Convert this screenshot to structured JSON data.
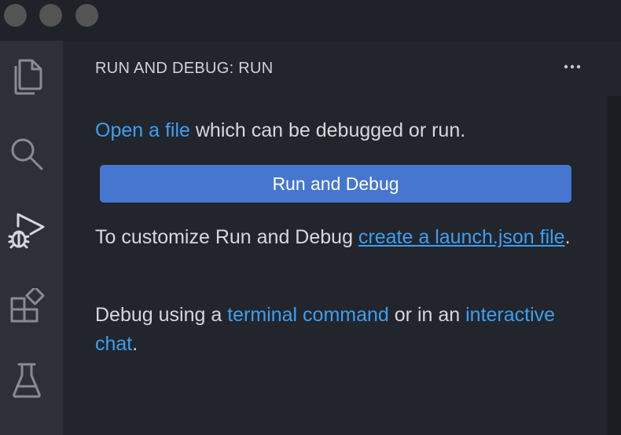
{
  "sidebar": {
    "title": "RUN AND DEBUG: RUN",
    "open_file": {
      "link": "Open a file",
      "rest": " which can be debugged or run."
    },
    "run_button_label": "Run and Debug",
    "customize": {
      "prefix": "To customize Run and Debug ",
      "link": "create a launch.json file",
      "suffix": "."
    },
    "debug_using": {
      "prefix": "Debug using a ",
      "link1": "terminal command",
      "middle": " or in an ",
      "link2": "interactive chat",
      "suffix": "."
    }
  },
  "activity_icons": [
    "files-icon",
    "search-icon",
    "run-debug-icon",
    "extensions-icon",
    "testing-icon"
  ],
  "colors": {
    "link": "#3d9ff0",
    "button": "#4676cf",
    "background": "#22252c",
    "activity_bar": "#2d3038"
  }
}
